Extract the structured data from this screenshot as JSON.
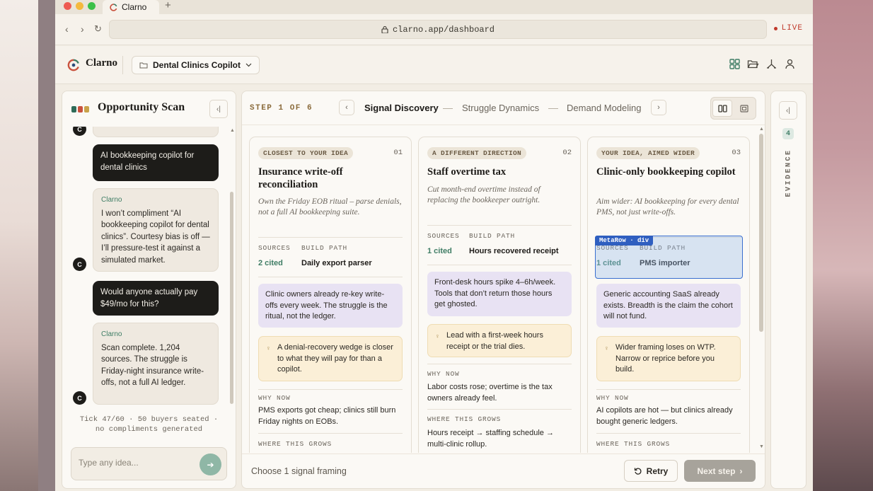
{
  "browser": {
    "tab_title": "Clarno",
    "new_tab": "+",
    "url": "clarno.app/dashboard",
    "live": "LIVE"
  },
  "app": {
    "brand": "Clarno",
    "project": "Dental Clinics Copilot"
  },
  "left_panel": {
    "title": "Opportunity Scan",
    "avatar": "C",
    "messages": [
      {
        "role": "user",
        "text": "AI bookkeeping copilot for dental clinics"
      },
      {
        "role": "bot",
        "author": "Clarno",
        "text": "I won’t compliment “AI bookkeeping copilot for dental clinics”. Courtesy bias is off — I’ll pressure-test it against a simulated market."
      },
      {
        "role": "user",
        "text": "Would anyone actually pay $49/mo for this?"
      },
      {
        "role": "bot",
        "author": "Clarno",
        "text": "Scan complete. 1,204 sources. The struggle is Friday-night insurance write-offs, not a full AI ledger."
      }
    ],
    "tick_line1": "Tick 47/60 · 50 buyers seated ·",
    "tick_line2": "no compliments generated",
    "input_placeholder": "Type any idea..."
  },
  "stepper": {
    "step_label": "STEP 1 OF 6",
    "tabs": [
      "Signal Discovery",
      "Struggle Dynamics",
      "Demand Modeling"
    ]
  },
  "cards": [
    {
      "tag": "CLOSEST TO YOUR IDEA",
      "num": "01",
      "title": "Insurance write-off reconciliation",
      "subtitle": "Own the Friday EOB ritual – parse denials, not a full AI bookkeeping suite.",
      "sources_label": "SOURCES",
      "build_label": "BUILD PATH",
      "sources": "2 cited",
      "build": "Daily export parser",
      "insight": "Clinic owners already re-key write-offs every week. The struggle is the ritual, not the ledger.",
      "tip": "A denial-recovery wedge is closer to what they will pay for than a copilot.",
      "why_label": "WHY NOW",
      "why": "PMS exports got cheap; clinics still burn Friday nights on EOBs.",
      "grows_label": "WHERE THIS GROWS"
    },
    {
      "tag": "A DIFFERENT DIRECTION",
      "num": "02",
      "title": "Staff overtime tax",
      "subtitle": "Cut month-end overtime instead of replacing the bookkeeper outright.",
      "sources_label": "SOURCES",
      "build_label": "BUILD PATH",
      "sources": "1 cited",
      "build": "Hours recovered receipt",
      "insight": "Front-desk hours spike 4–6h/week. Tools that don’t return those hours get ghosted.",
      "tip": "Lead with a first-week hours receipt or the trial dies.",
      "why_label": "WHY NOW",
      "why": "Labor costs rose; overtime is the tax owners already feel.",
      "grows_label": "WHERE THIS GROWS",
      "grows": "Hours receipt → staffing schedule → multi-clinic rollup."
    },
    {
      "tag": "YOUR IDEA, AIMED WIDER",
      "num": "03",
      "title": "Clinic-only bookkeeping copilot",
      "subtitle": "Aim wider: AI bookkeeping for every dental PMS, not just write-offs.",
      "sources_label": "SOURCES",
      "build_label": "BUILD PATH",
      "sources": "1 cited",
      "build": "PMS importer",
      "insight": "Generic accounting SaaS already exists. Breadth is the claim the cohort will not fund.",
      "tip": "Wider framing loses on WTP. Narrow or reprice before you build.",
      "why_label": "WHY NOW",
      "why": "AI copilots are hot — but clinics already bought generic ledgers.",
      "grows_label": "WHERE THIS GROWS",
      "highlight_label": "MetaRow · div"
    }
  ],
  "footer": {
    "choose": "Choose 1 signal framing",
    "retry": "Retry",
    "next": "Next step"
  },
  "evidence": {
    "count": "4",
    "label": "EVIDENCE"
  },
  "colors": {
    "accent_green": "#3f7d65",
    "live_red": "#c0392b",
    "highlight_blue": "#2f5fc0"
  }
}
